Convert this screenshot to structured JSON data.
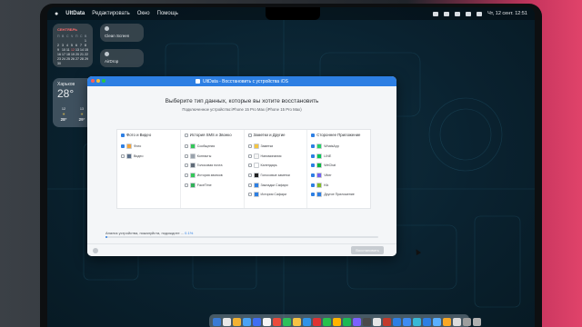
{
  "menubar": {
    "apple_icon": "apple-icon",
    "app_name": "UltData",
    "items": [
      "Редактировать",
      "Окно",
      "Помощь"
    ],
    "datetime": "Чт, 12 сент.  12:51"
  },
  "widgets": {
    "calendar": {
      "month": "СЕНТЯБРЬ",
      "weekdays": [
        "П",
        "В",
        "С",
        "Ч",
        "П",
        "С",
        "В"
      ],
      "days": [
        "",
        "",
        "",
        "",
        "",
        "",
        "1",
        "2",
        "3",
        "4",
        "5",
        "6",
        "7",
        "8",
        "9",
        "10",
        "11",
        "12",
        "13",
        "14",
        "15",
        "16",
        "17",
        "18",
        "19",
        "20",
        "21",
        "22",
        "23",
        "24",
        "25",
        "26",
        "27",
        "28",
        "29",
        "30"
      ]
    },
    "tiles": [
      "Clean Screen",
      "AirDrop"
    ],
    "weather": {
      "city": "Харьков",
      "temp": "28°",
      "condition": "Преимущественно солн...",
      "forecast": [
        {
          "time": "12",
          "temp": "28°"
        },
        {
          "time": "13",
          "temp": "29°"
        },
        {
          "time": "14",
          "temp": "29°"
        },
        {
          "time": "15",
          "temp": "29°"
        },
        {
          "time": "16",
          "temp": "29°"
        },
        {
          "time": "17",
          "temp": "28°"
        }
      ]
    }
  },
  "dialog": {
    "title": "UltData - Восстановить с устройства iOS",
    "heading": "Выберите тип данных, которые вы хотите восстановить",
    "subheading": "Подключенное устройство:iPhone 15 Pro Max (iPhone 15 Pro Max)",
    "columns": [
      {
        "title": "Фото и Видео",
        "checked": true,
        "items": [
          {
            "label": "Фото",
            "checked": true,
            "icon_color": "#f3a43b"
          },
          {
            "label": "Видео",
            "checked": false,
            "icon_color": "#5a6f8a"
          }
        ]
      },
      {
        "title": "История SMS и Звонко",
        "checked": false,
        "items": [
          {
            "label": "Сообщения",
            "checked": false,
            "icon_color": "#34c759"
          },
          {
            "label": "Контакты",
            "checked": false,
            "icon_color": "#9aa3ad"
          },
          {
            "label": "Голосовая почта",
            "checked": false,
            "icon_color": "#5f6b78"
          },
          {
            "label": "История звонков",
            "checked": false,
            "icon_color": "#34c759"
          },
          {
            "label": "FaceTime",
            "checked": false,
            "icon_color": "#30b158"
          }
        ]
      },
      {
        "title": "Заметки и Другие",
        "checked": false,
        "items": [
          {
            "label": "Заметки",
            "checked": false,
            "icon_color": "#f5c542"
          },
          {
            "label": "Напоминания",
            "checked": false,
            "icon_color": "#f5f5f5"
          },
          {
            "label": "Календарь",
            "checked": false,
            "icon_color": "#ffffff"
          },
          {
            "label": "Голосовые заметки",
            "checked": false,
            "icon_color": "#222222"
          },
          {
            "label": "Закладки Сафари",
            "checked": false,
            "icon_color": "#2d7fe3"
          },
          {
            "label": "История Сафари",
            "checked": false,
            "icon_color": "#2d7fe3"
          }
        ]
      },
      {
        "title": "Стороннее Приложение",
        "checked": true,
        "items": [
          {
            "label": "WhatsApp",
            "checked": true,
            "icon_color": "#25d366"
          },
          {
            "label": "LINE",
            "checked": true,
            "icon_color": "#06c755"
          },
          {
            "label": "WeChat",
            "checked": true,
            "icon_color": "#09b83e"
          },
          {
            "label": "Viber",
            "checked": true,
            "icon_color": "#7360f2"
          },
          {
            "label": "Kik",
            "checked": true,
            "icon_color": "#82bc23"
          },
          {
            "label": "Другое Приложение",
            "checked": true,
            "icon_color": "#2d7fe3"
          }
        ]
      }
    ],
    "progress_label": "Анализ устройства, пожалуйста, подождите ...",
    "progress_percent": "0.1%",
    "progress_fraction": 0.001,
    "recover_button": "Восстановить"
  },
  "dock": {
    "icon_colors": [
      "#3a7bd5",
      "#e8e8e8",
      "#f2b233",
      "#4aa3f5",
      "#3e6ef2",
      "#f5f5f5",
      "#e94b3c",
      "#2fc05a",
      "#f6c244",
      "#2f93e8",
      "#d33",
      "#27c24c",
      "#ffb400",
      "#1db954",
      "#7b61ff",
      "#4a4a4a",
      "#e6e6e6",
      "#c23a2b",
      "#2d7fe3",
      "#3d8cf2",
      "#39b8d6",
      "#2d7fe3",
      "#5ab0ff",
      "#f9a825",
      "#dcdcdc",
      "#9e9e9e",
      "#b0b0b0"
    ]
  },
  "colors": {
    "accent": "#2d7fe3",
    "dialog_bg": "#f4f6f8"
  }
}
